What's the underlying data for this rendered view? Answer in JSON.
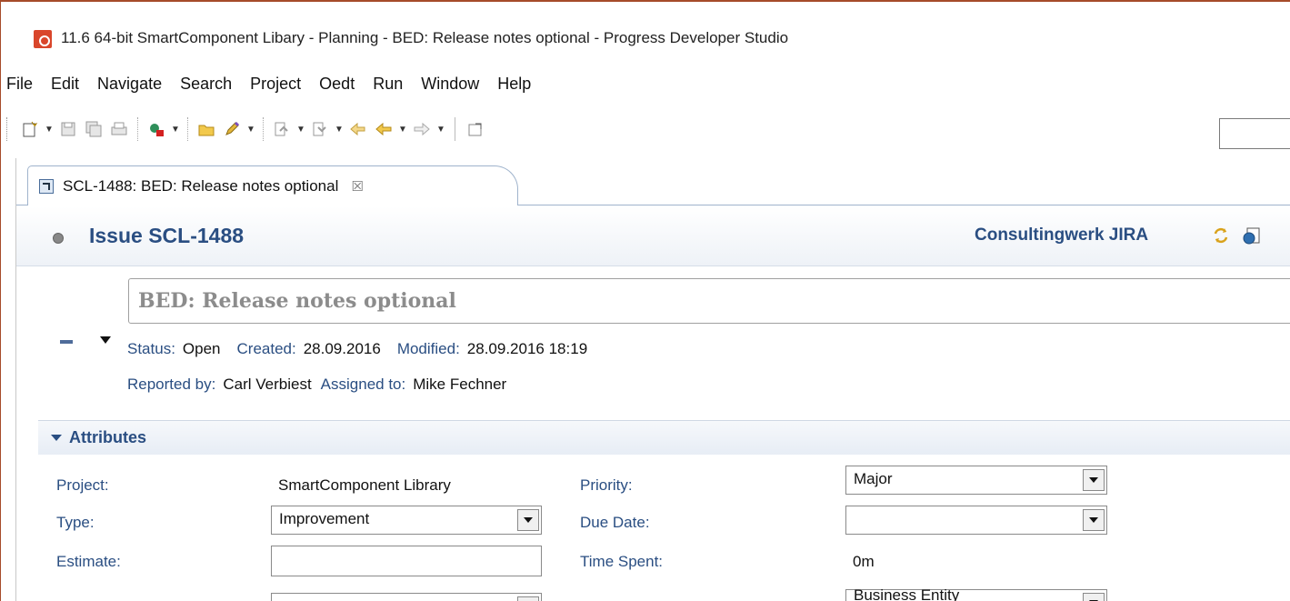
{
  "window": {
    "title": "11.6 64-bit SmartComponent Libary - Planning - BED: Release notes optional - Progress Developer Studio"
  },
  "menu": {
    "items": [
      "File",
      "Edit",
      "Navigate",
      "Search",
      "Project",
      "Oedt",
      "Run",
      "Window",
      "Help"
    ]
  },
  "toolbar": {
    "icons": [
      "new-wizard-icon",
      "save-icon",
      "save-all-icon",
      "print-icon",
      "debug-icon",
      "open-folder-icon",
      "pen-icon",
      "next-annotation-icon",
      "prev-annotation-icon",
      "back-icon",
      "forward-icon",
      "maximize-icon"
    ]
  },
  "editor": {
    "tab": {
      "label": "SCL-1488: BED: Release notes optional",
      "close": "☒"
    },
    "header": {
      "issue_title": "Issue SCL-1488",
      "repository": "Consultingwerk JIRA"
    },
    "summary": "BED: Release notes optional",
    "meta": {
      "status_label": "Status:",
      "status_value": "Open",
      "created_label": "Created:",
      "created_value": "28.09.2016",
      "modified_label": "Modified:",
      "modified_value": "28.09.2016 18:19",
      "reported_label": "Reported by:",
      "reported_value": "Carl Verbiest",
      "assigned_label": "Assigned to:",
      "assigned_value": "Mike Fechner"
    },
    "attributes": {
      "section_label": "Attributes",
      "project_label": "Project:",
      "project_value": "SmartComponent Library",
      "type_label": "Type:",
      "type_value": "Improvement",
      "estimate_label": "Estimate:",
      "estimate_value": "",
      "priority_label": "Priority:",
      "priority_value": "Major",
      "due_label": "Due Date:",
      "due_value": "",
      "time_spent_label": "Time Spent:",
      "time_spent_value": "0m",
      "component_value": "Business Entity"
    }
  },
  "colors": {
    "accent_blue": "#2a4e82",
    "window_border": "#a64b2a",
    "app_icon": "#d9462b"
  }
}
